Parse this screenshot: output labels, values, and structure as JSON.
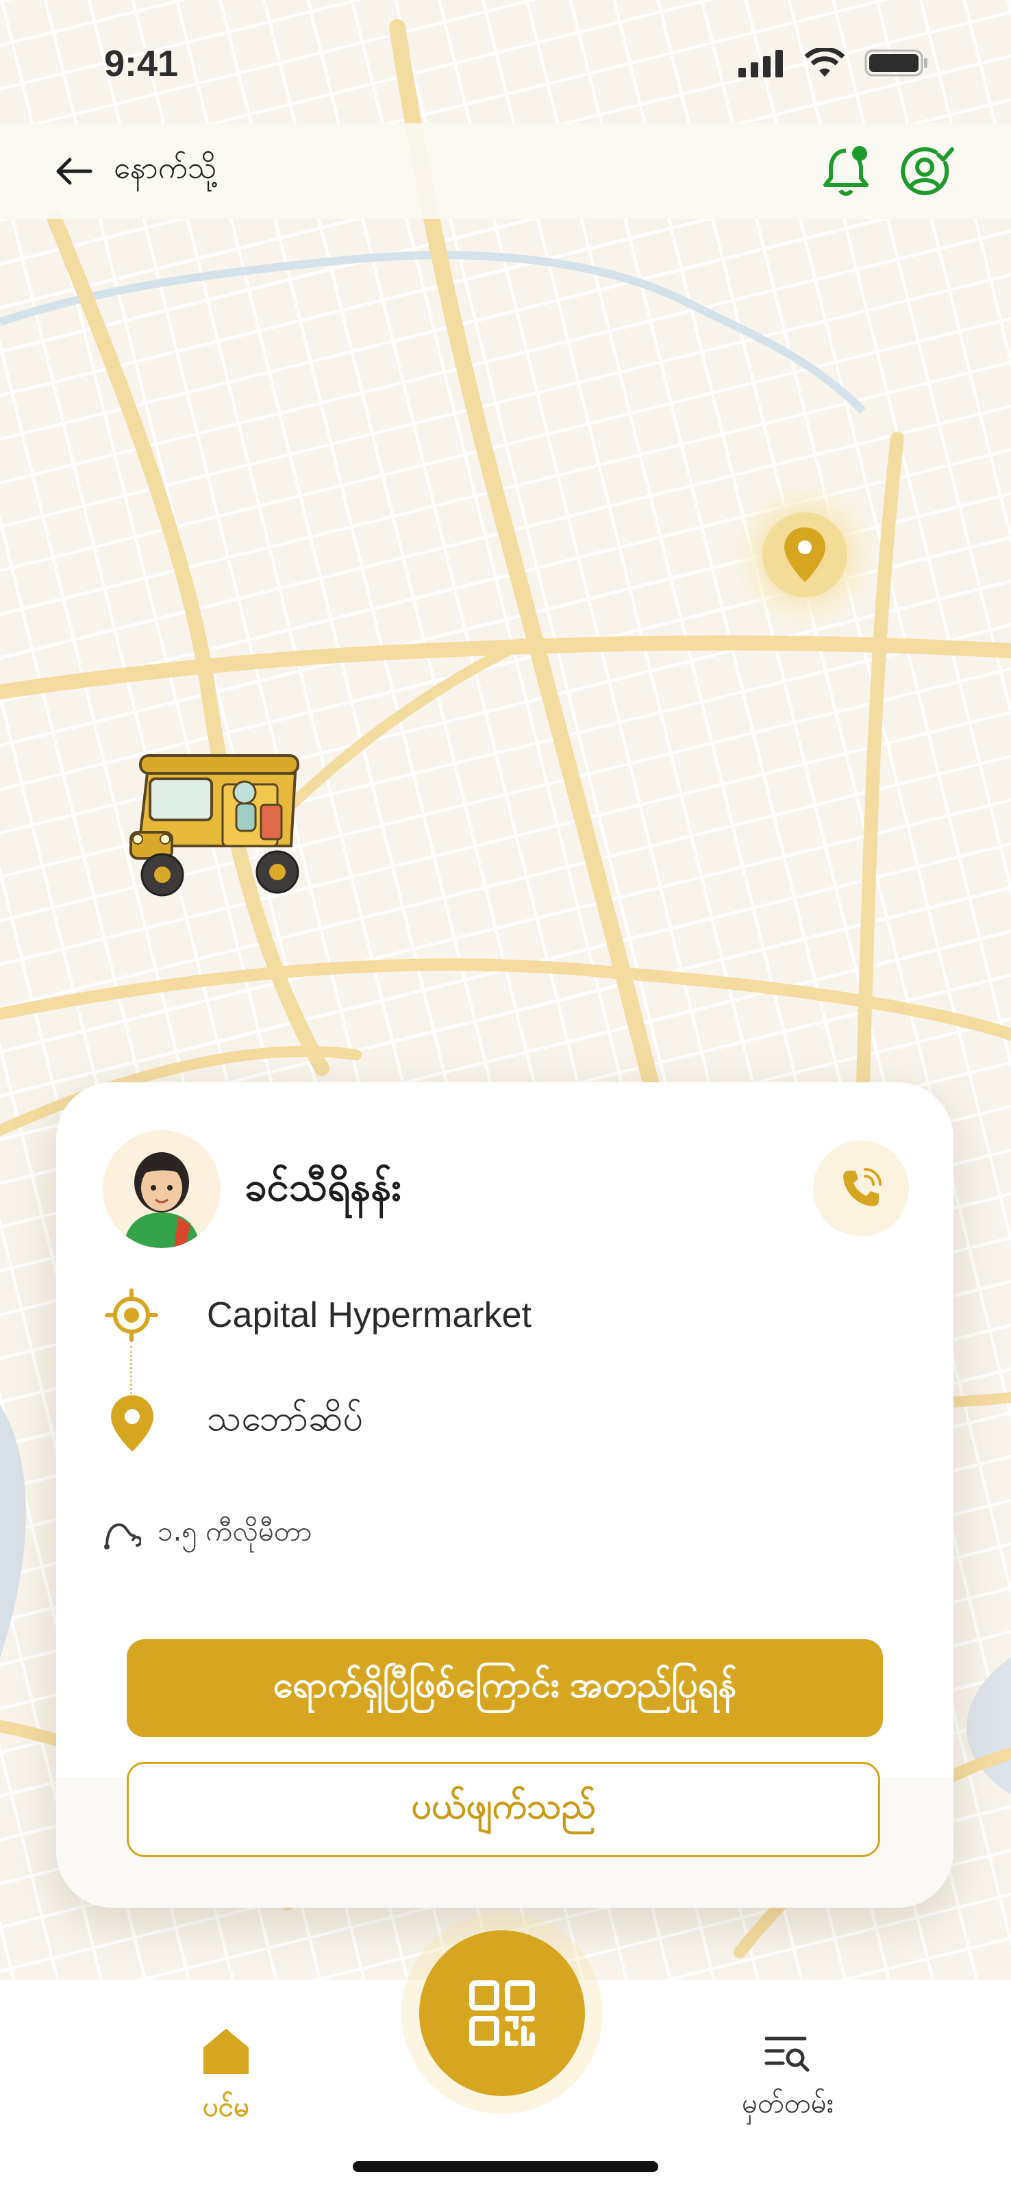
{
  "status_bar": {
    "time": "9:41"
  },
  "top_bar": {
    "back_label": "နောက်သို့"
  },
  "driver": {
    "name": "ခင်သီရိနန်း"
  },
  "trip": {
    "pickup": "Capital Hypermarket",
    "dropoff": "သဘော်ဆိပ်",
    "distance": "၁.၅ ကီလိုမီတာ"
  },
  "actions": {
    "confirm_label": "ရောက်ရှိပြီဖြစ်ကြောင်း အတည်ပြုရန်",
    "cancel_label": "ပယ်ဖျက်သည်"
  },
  "bottom_nav": {
    "home_label": "ပင်မ",
    "history_label": "မှတ်တမ်း"
  },
  "colors": {
    "accent": "#d6a620",
    "map_road": "#f5dfa6",
    "map_bg": "#f8f4ec",
    "icon_green": "#1f9b2e"
  }
}
